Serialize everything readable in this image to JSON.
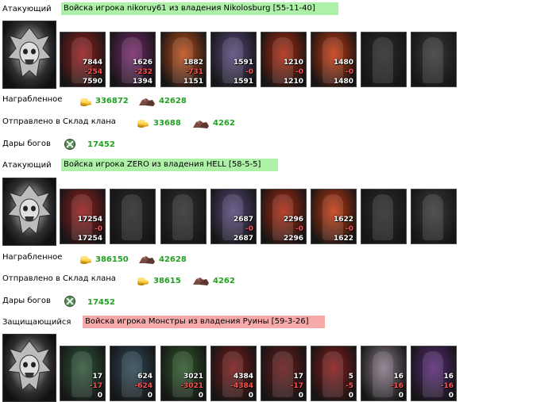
{
  "labels": {
    "loot": "Награбленное",
    "sent": "Отправлено в Склад клана",
    "gifts": "Дары богов"
  },
  "battles": [
    {
      "role": "Атакующий",
      "banner": "Войска игрока nikoruy61 из владения Nikolosburg [55-11-40]",
      "banner_color": "#aef0a8",
      "units": [
        {
          "before": "7844",
          "loss": "-254",
          "after": "7590",
          "color": "#9a1e1e"
        },
        {
          "before": "1626",
          "loss": "-232",
          "after": "1394",
          "color": "#7a2a70"
        },
        {
          "before": "1882",
          "loss": "-731",
          "after": "1151",
          "color": "#c0501a"
        },
        {
          "before": "1591",
          "loss": "-0",
          "after": "1591",
          "color": "#5a4a80"
        },
        {
          "before": "1210",
          "loss": "-0",
          "after": "1210",
          "color": "#b02a10"
        },
        {
          "before": "1480",
          "loss": "-0",
          "after": "1480",
          "color": "#c83a10"
        },
        {
          "before": "",
          "loss": "",
          "after": "",
          "color": "#2a2a2a"
        },
        {
          "before": "",
          "loss": "",
          "after": "",
          "color": "#3a3a3a"
        }
      ],
      "loot": {
        "gold": "336872",
        "ore": "42628"
      },
      "sent": {
        "gold": "33688",
        "ore": "4262"
      },
      "gifts": "17452"
    },
    {
      "role": "Атакующий",
      "banner": "Войска игрока ZERO из владения HELL [58-5-5]",
      "banner_color": "#aef0a8",
      "units": [
        {
          "before": "17254",
          "loss": "-0",
          "after": "17254",
          "color": "#9a1e1e"
        },
        {
          "before": "",
          "loss": "",
          "after": "",
          "color": "#2a2a2a"
        },
        {
          "before": "",
          "loss": "",
          "after": "",
          "color": "#303030"
        },
        {
          "before": "2687",
          "loss": "-0",
          "after": "2687",
          "color": "#5a4a80"
        },
        {
          "before": "2296",
          "loss": "-0",
          "after": "2296",
          "color": "#b02a10"
        },
        {
          "before": "1622",
          "loss": "-0",
          "after": "1622",
          "color": "#c83a10"
        },
        {
          "before": "",
          "loss": "",
          "after": "",
          "color": "#2a2a2a"
        },
        {
          "before": "",
          "loss": "",
          "after": "",
          "color": "#3a3a3a"
        }
      ],
      "loot": {
        "gold": "386150",
        "ore": "42628"
      },
      "sent": {
        "gold": "38615",
        "ore": "4262"
      },
      "gifts": "17452"
    },
    {
      "role": "Защищающийся",
      "banner": "Войска игрока Монстры из владения Руины [59-3-26]",
      "banner_color": "#f5a9a9",
      "units": [
        {
          "before": "17",
          "loss": "-17",
          "after": "0",
          "color": "#2e5a3a"
        },
        {
          "before": "624",
          "loss": "-624",
          "after": "0",
          "color": "#2e4a5a"
        },
        {
          "before": "3021",
          "loss": "-3021",
          "after": "0",
          "color": "#2e5a2a"
        },
        {
          "before": "4384",
          "loss": "-4384",
          "after": "0",
          "color": "#7a1a1a"
        },
        {
          "before": "17",
          "loss": "-17",
          "after": "0",
          "color": "#6a1a1a"
        },
        {
          "before": "5",
          "loss": "-5",
          "after": "0",
          "color": "#8a1a1a"
        },
        {
          "before": "16",
          "loss": "-16",
          "after": "0",
          "color": "#8a7a8a"
        },
        {
          "before": "16",
          "loss": "-16",
          "after": "0",
          "color": "#5a2a7a"
        }
      ]
    }
  ]
}
